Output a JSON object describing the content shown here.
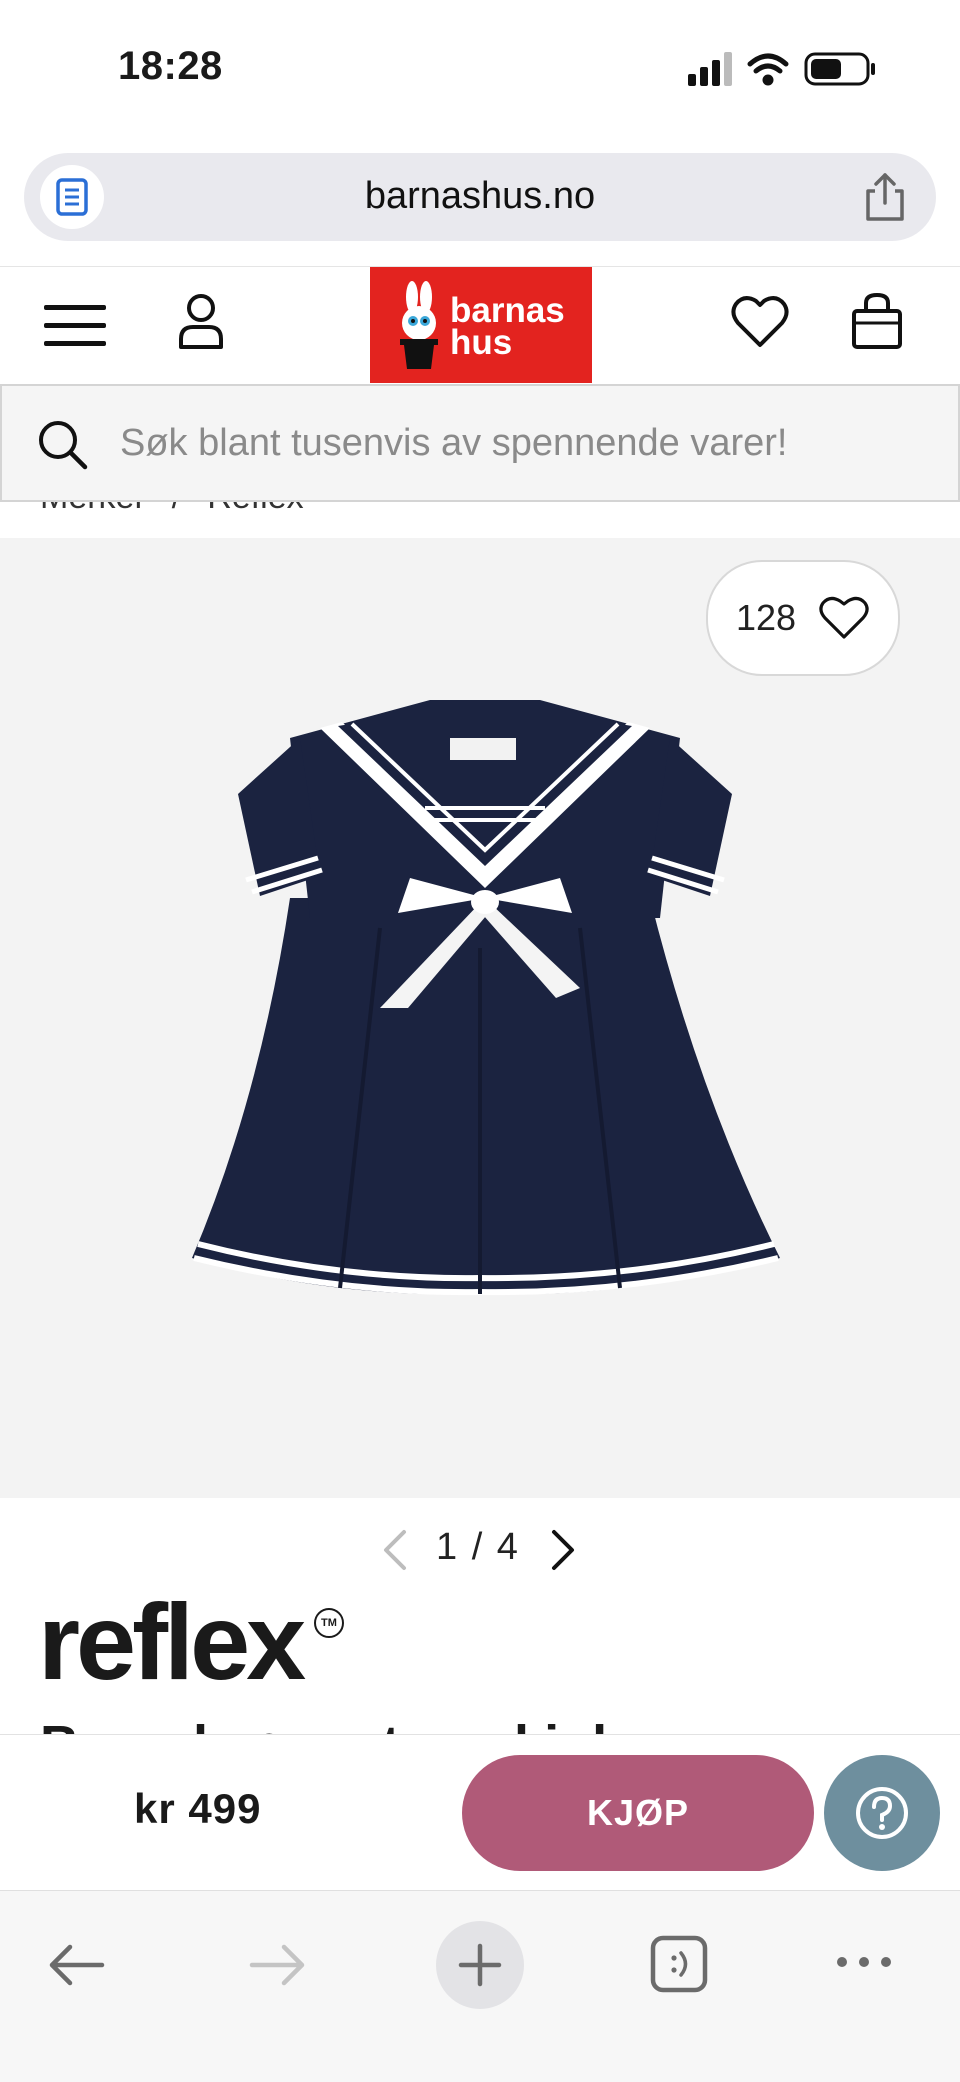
{
  "status_bar": {
    "time": "18:28"
  },
  "browser": {
    "url": "barnashus.no"
  },
  "site": {
    "logo_line1": "barnas",
    "logo_line2": "hus",
    "search_placeholder": "Søk blant tusenvis av spennende varer!",
    "breadcrumb": [
      "Merker",
      "/",
      "Reflex"
    ]
  },
  "product": {
    "like_count": "128",
    "pager": "1 / 4",
    "brand": "reflex",
    "brand_mark": "TM",
    "title_peek": "Bunad og matrosskjole",
    "price": "kr 499",
    "buy_label": "KJØP",
    "image_icon": "sailor-dress-image"
  },
  "colors": {
    "logo_red": "#e3231f",
    "buy_pink": "#b05a78",
    "help_blue": "#6e8f9e",
    "dress_navy": "#1b2340"
  }
}
